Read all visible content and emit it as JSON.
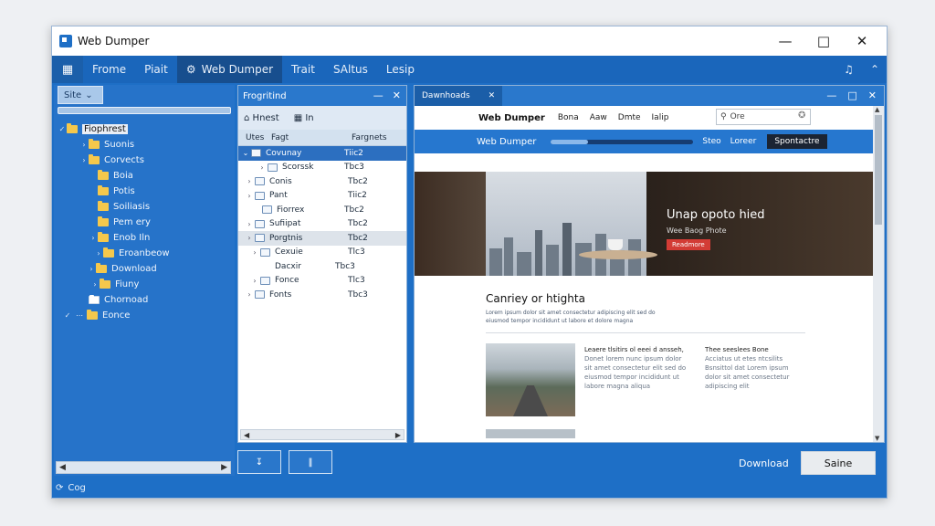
{
  "window": {
    "title": "Web Dumper"
  },
  "menu": {
    "items": [
      "Frome",
      "Piait",
      "Web Dumper",
      "Trait",
      "SAltus",
      "Lesip"
    ]
  },
  "left_panel": {
    "site_dropdown": "Site",
    "tree": [
      {
        "label": "Fiophrest",
        "expanded": true,
        "selected": true
      },
      {
        "label": "Suonis"
      },
      {
        "label": "Corvects"
      },
      {
        "label": "Boia"
      },
      {
        "label": "Potis"
      },
      {
        "label": "Soiliasis"
      },
      {
        "label": "Pem ery"
      },
      {
        "label": "Enob Iln"
      },
      {
        "label": "Eroanbeow"
      },
      {
        "label": "Download"
      },
      {
        "label": "Fiuny"
      },
      {
        "label": "Chornoad"
      },
      {
        "label": "Eonce"
      }
    ]
  },
  "mid_panel": {
    "title": "Frogritind",
    "tools": [
      "Hnest",
      "In"
    ],
    "columns": [
      "Utes",
      "Fagt",
      "Fargnets"
    ],
    "files": [
      {
        "name": "Covunay",
        "size": "Tiic2"
      },
      {
        "name": "Scorssk",
        "size": "Tbc3"
      },
      {
        "name": "Conis",
        "size": "Tbc2"
      },
      {
        "name": "Pant",
        "size": "Tiic2"
      },
      {
        "name": "Fiorrex",
        "size": "Tbc2"
      },
      {
        "name": "Sufiipat",
        "size": "Tbc2"
      },
      {
        "name": "Porgtnis",
        "size": "Tbc2"
      },
      {
        "name": "Cexuie",
        "size": "Tlc3"
      },
      {
        "name": "Dacxir",
        "size": "Tbc3"
      },
      {
        "name": "Fonce",
        "size": "Tlc3"
      },
      {
        "name": "Fonts",
        "size": "Tbc3"
      }
    ]
  },
  "right_panel": {
    "tab_title": "Dawnhoads",
    "site": {
      "brand": "Web Dumper",
      "nav_links": [
        "Bona",
        "Aaw",
        "Dmte",
        "Ialip"
      ],
      "search_placeholder": "Ore",
      "bar_links": [
        "Steo",
        "Loreer"
      ],
      "bar_button": "Spontactre",
      "progress": 0.26,
      "hero_title": "Unap opoto hied",
      "hero_subtitle": "Wee Baog Phote",
      "hero_button": "Readmore",
      "article_title": "Canriey or htighta",
      "article_summary": "Lorem ipsum dolor sit amet consectetur adipiscing elit sed do eiusmod tempor incididunt ut labore et dolore magna",
      "col1_heading": "Leaere tlsitirs ol eeei d ansseh,",
      "col1_body": "Donet lorem nunc ipsum dolor sit amet consectetur elit sed do eiusmod tempor incididunt ut labore magna aliqua",
      "col2_heading": "Thee seeslees Bone",
      "col2_body": "Acciatus ut etes ntcsilits Bsnsittol dat Lorem ipsum dolor sit amet consectetur adipiscing elit"
    }
  },
  "bottom": {
    "download_label": "Download",
    "save_label": "Saine",
    "status_text": "Cog"
  }
}
